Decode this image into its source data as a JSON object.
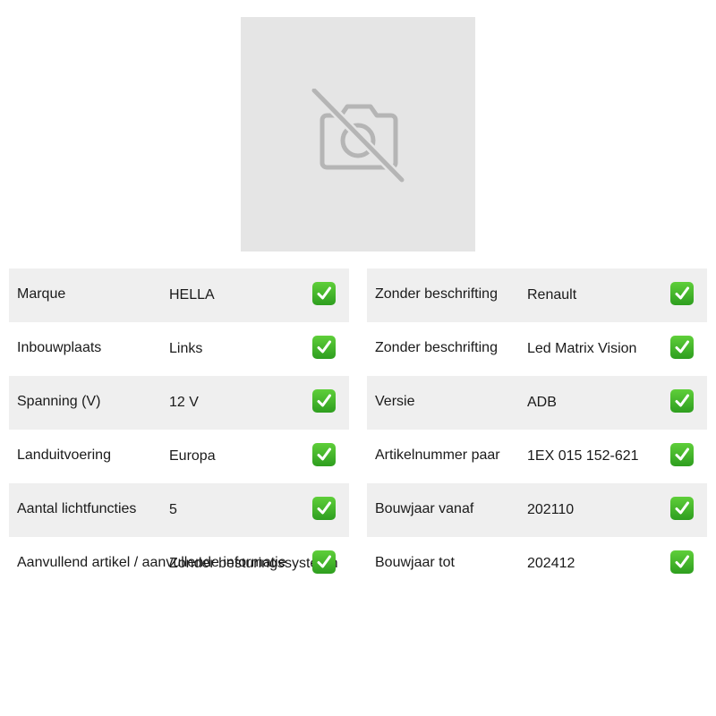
{
  "product_image": {
    "icon": "no-photo-icon"
  },
  "check_icon": "check-mark-icon",
  "specs_left": [
    {
      "label": "Marque",
      "value": "HELLA"
    },
    {
      "label": "Inbouwplaats",
      "value": "Links"
    },
    {
      "label": "Spanning (V)",
      "value": "12 V"
    },
    {
      "label": "Landuitvoering",
      "value": "Europa"
    },
    {
      "label": "Aantal lichtfuncties",
      "value": "5"
    },
    {
      "label": "Aanvullend artikel / aanvullende informatie",
      "value": "Zonder besturingssysteem"
    }
  ],
  "specs_right": [
    {
      "label": "Zonder beschrifting",
      "value": "Renault"
    },
    {
      "label": "Zonder beschrifting",
      "value": "Led Matrix Vision"
    },
    {
      "label": "Versie",
      "value": "ADB"
    },
    {
      "label": "Artikelnummer paar",
      "value": "1EX 015 152-621"
    },
    {
      "label": "Bouwjaar vanaf",
      "value": "202110"
    },
    {
      "label": "Bouwjaar tot",
      "value": "202412"
    }
  ]
}
